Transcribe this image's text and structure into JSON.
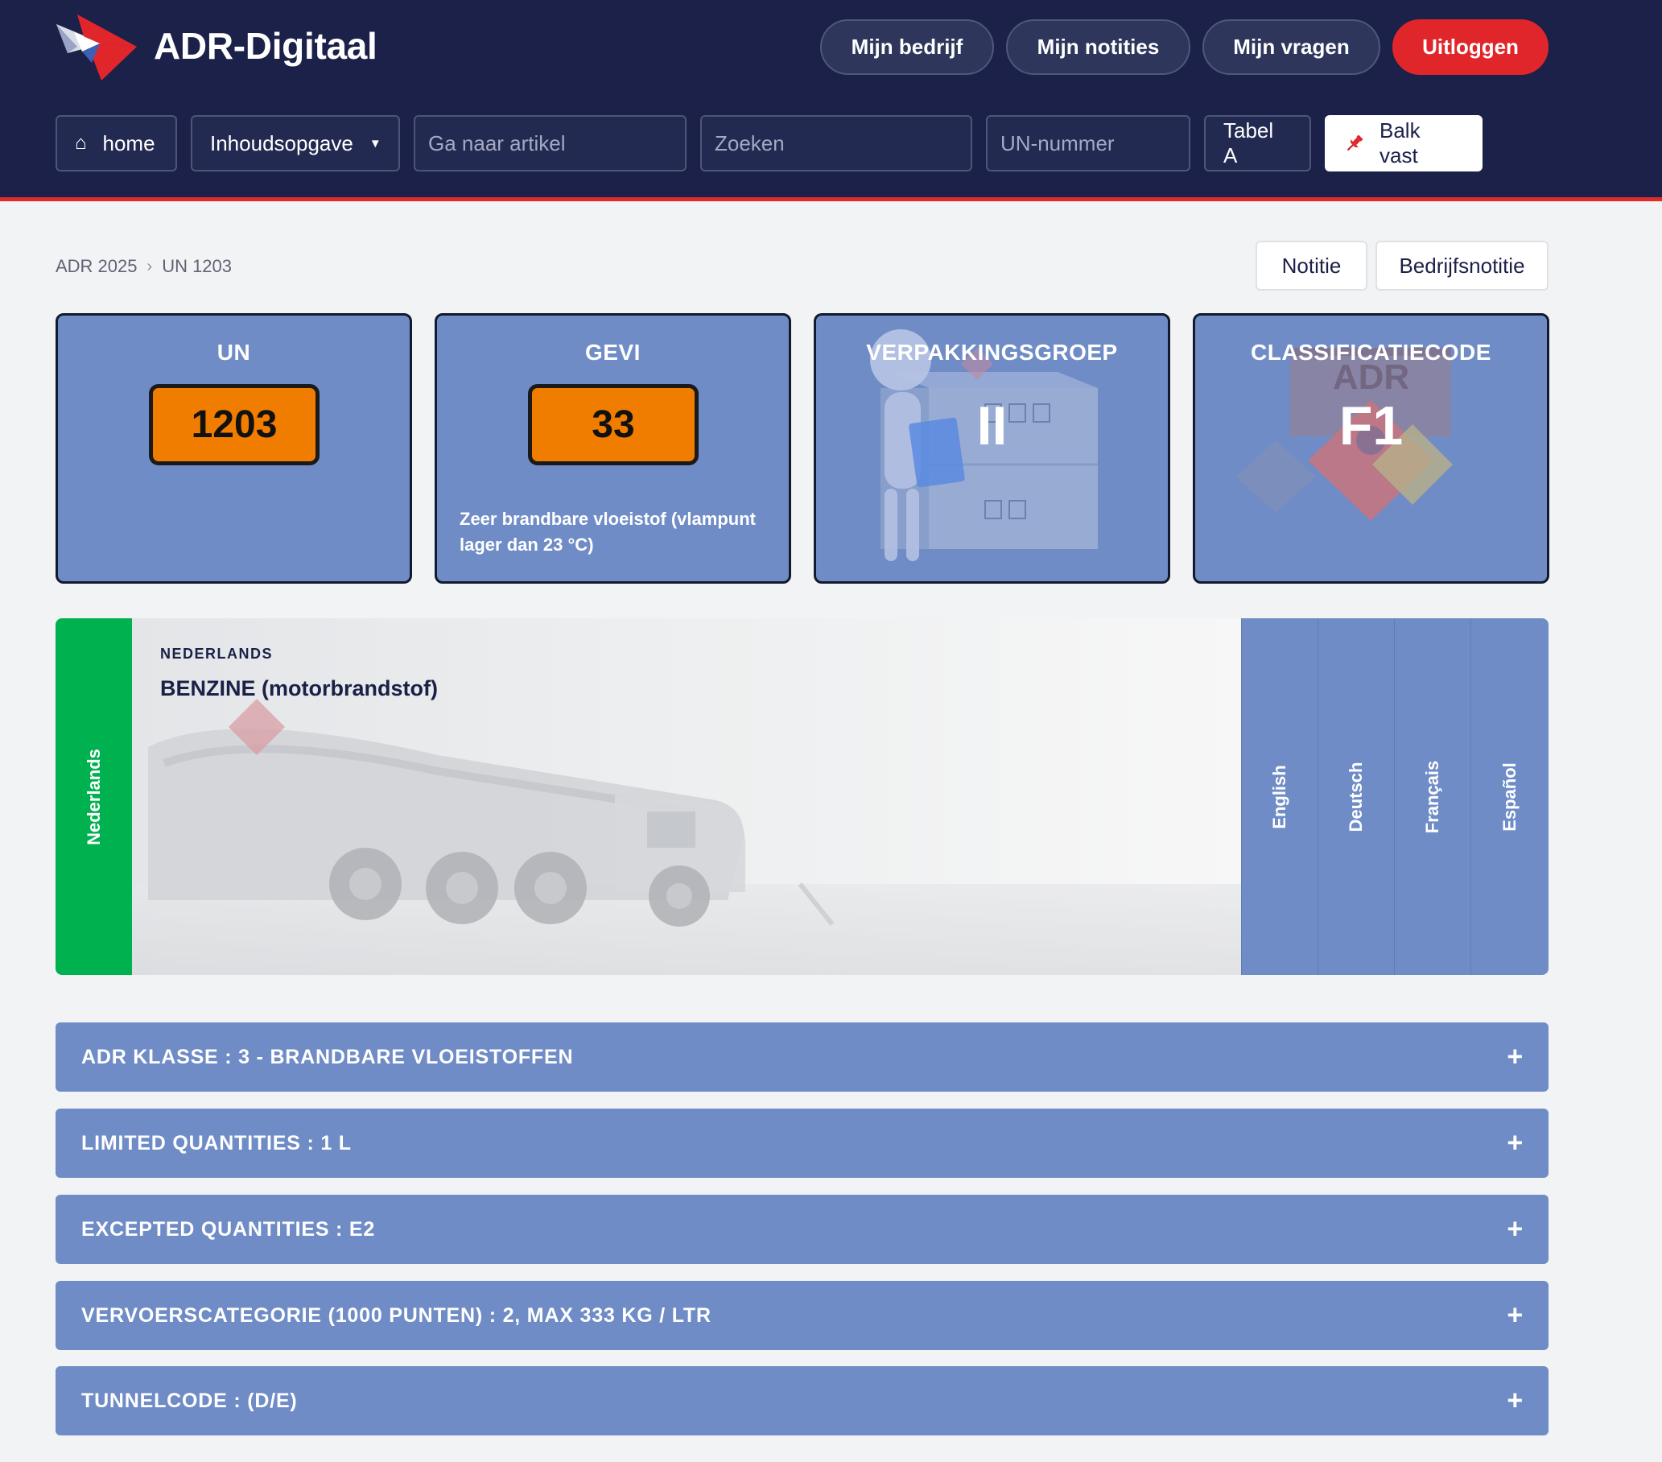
{
  "header": {
    "brand": "ADR-Digitaal",
    "nav": {
      "company": "Mijn bedrijf",
      "notes": "Mijn notities",
      "questions": "Mijn vragen",
      "logout": "Uitloggen"
    },
    "toolbar": {
      "home": "home",
      "contents": "Inhoudsopgave",
      "article_placeholder": "Ga naar artikel",
      "search_placeholder": "Zoeken",
      "un_placeholder": "UN-nummer",
      "table_a": "Tabel A",
      "pin_bar": "Balk vast"
    }
  },
  "breadcrumb": {
    "items": [
      "ADR 2025",
      "UN 1203"
    ],
    "separator": "›"
  },
  "note_buttons": {
    "note": "Notitie",
    "company_note": "Bedrijfsnotitie"
  },
  "cards": {
    "un": {
      "title": "UN",
      "value": "1203"
    },
    "gevi": {
      "title": "GEVI",
      "value": "33",
      "description": "Zeer brandbare vloeistof (vlampunt lager dan 23 °C)"
    },
    "packing": {
      "title": "VERPAKKINGSGROEP",
      "value": "II"
    },
    "classification": {
      "title": "CLASSIFICATIECODE",
      "value": "F1",
      "art_label": "ADR"
    }
  },
  "language_panel": {
    "active_tab": "Nederlands",
    "label": "NEDERLANDS",
    "name": "BENZINE (motorbrandstof)",
    "tabs": [
      "English",
      "Deutsch",
      "Français",
      "Español"
    ]
  },
  "accordions": [
    {
      "label": "ADR KLASSE : 3 - BRANDBARE VLOEISTOFFEN",
      "icon": "+"
    },
    {
      "label": "LIMITED QUANTITIES : 1 L",
      "icon": "+"
    },
    {
      "label": "EXCEPTED QUANTITIES : E2",
      "icon": "+"
    },
    {
      "label": "VERVOERSCATEGORIE (1000 PUNTEN) : 2, MAX 333 KG / LTR",
      "icon": "+"
    },
    {
      "label": "TUNNELCODE : (D/E)",
      "icon": "+"
    }
  ],
  "colors": {
    "header_bg": "#1b2149",
    "accent_red": "#e1262b",
    "card_blue": "#6f8cc6",
    "orange_plate": "#f07d00",
    "active_green": "#00b14f"
  }
}
